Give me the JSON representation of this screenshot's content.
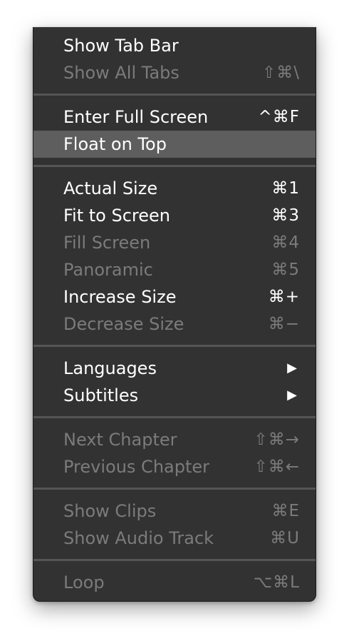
{
  "menu": {
    "groups": [
      [
        {
          "label": "Show Tab Bar",
          "shortcut": "",
          "enabled": true
        },
        {
          "label": "Show All Tabs",
          "shortcut": "⇧⌘\\",
          "enabled": false
        }
      ],
      [
        {
          "label": "Enter Full Screen",
          "shortcut": "^⌘F",
          "enabled": true
        },
        {
          "label": "Float on Top",
          "shortcut": "",
          "enabled": true,
          "highlighted": true
        }
      ],
      [
        {
          "label": "Actual Size",
          "shortcut": "⌘1",
          "enabled": true
        },
        {
          "label": "Fit to Screen",
          "shortcut": "⌘3",
          "enabled": true
        },
        {
          "label": "Fill Screen",
          "shortcut": "⌘4",
          "enabled": false
        },
        {
          "label": "Panoramic",
          "shortcut": "⌘5",
          "enabled": false
        },
        {
          "label": "Increase Size",
          "shortcut": "⌘+",
          "enabled": true
        },
        {
          "label": "Decrease Size",
          "shortcut": "⌘−",
          "enabled": false
        }
      ],
      [
        {
          "label": "Languages",
          "submenu": true,
          "enabled": true
        },
        {
          "label": "Subtitles",
          "submenu": true,
          "enabled": true
        }
      ],
      [
        {
          "label": "Next Chapter",
          "shortcut": "⇧⌘→",
          "enabled": false
        },
        {
          "label": "Previous Chapter",
          "shortcut": "⇧⌘←",
          "enabled": false
        }
      ],
      [
        {
          "label": "Show Clips",
          "shortcut": "⌘E",
          "enabled": false
        },
        {
          "label": "Show Audio Track",
          "shortcut": "⌘U",
          "enabled": false
        }
      ],
      [
        {
          "label": "Loop",
          "shortcut": "⌥⌘L",
          "enabled": false
        }
      ]
    ],
    "submenu_glyph": "▶",
    "colors": {
      "background": "#323232",
      "text_enabled": "#ffffff",
      "text_disabled": "#7b7b7b",
      "highlight": "#5e5e5e",
      "separator": "#555555"
    }
  }
}
